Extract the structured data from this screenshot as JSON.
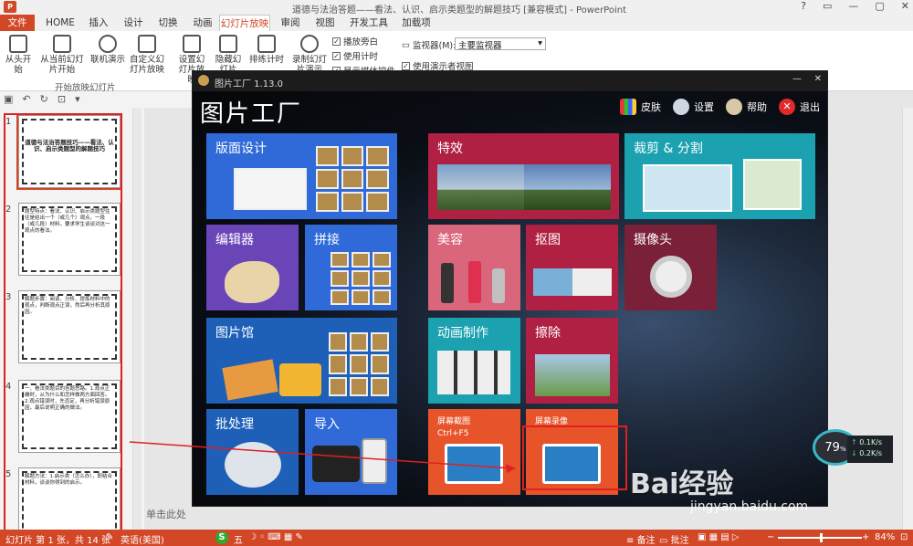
{
  "titlebar": {
    "title": "道德与法治答题——看法、认识、启示类题型的解题技巧 [兼容模式] - PowerPoint",
    "controls": [
      "?",
      "▭",
      "—",
      "▢",
      "✕"
    ]
  },
  "tabs": [
    "文件",
    "HOME",
    "插入",
    "设计",
    "切换",
    "动画",
    "幻灯片放映",
    "审阅",
    "视图",
    "开发工具",
    "加载项"
  ],
  "ribbon": {
    "from_start": "从头开始",
    "from_current": "从当前幻灯片开始",
    "online": "联机演示",
    "custom": "自定义幻灯片放映",
    "setup": "设置幻灯片放映",
    "hide": "隐藏幻灯片",
    "rehearse": "排练计时",
    "record": "录制幻灯片演示",
    "chk_play_narration": "播放旁白",
    "chk_use_timing": "使用计时",
    "chk_show_media": "显示媒体控件",
    "monitor_label": "监视器(M):",
    "monitor_value": "主要监视器",
    "presenter_view": "使用演示者视图",
    "group_label": "开始放映幻灯片"
  },
  "slides": [
    {
      "num": "1",
      "text": "道德与法治答题技巧——看法、认识、启示类题型的解题技巧"
    },
    {
      "num": "2",
      "text": "题型特点：看法、认识、启示类题型往往是给出一个（或几个）观点，一段（或几段）材料，要求学生谈谈对这一观点的看法。"
    },
    {
      "num": "3",
      "text": "解题步骤：阅读、分析、提炼材料中的观点，判断观点正误，然后再分析其原因。"
    },
    {
      "num": "4",
      "text": "一、看法类题目的答题思路。1.观点正确时，从为什么和怎样做两方面回答。2.观点错误时，先否定，再分析错误原因，最后说明正确的做法。"
    },
    {
      "num": "5",
      "text": "解题方法：1.启示类（怎么办），即结合材料，谈谈你得到的启示。"
    }
  ],
  "notes_placeholder": "单击此处",
  "statusbar": {
    "slide": "幻灯片 第 1 张，共 14 张",
    "lang": "英语(美国)",
    "notes": "备注",
    "comments": "批注",
    "zoom": "84%",
    "ime": "五"
  },
  "pf": {
    "title": "图片工厂 1.13.0",
    "name": "图片工厂",
    "skin": "皮肤",
    "settings": "设置",
    "help": "帮助",
    "exit": "退出",
    "tiles": {
      "layout": "版面设计",
      "effects": "特效",
      "crop": "裁剪 & 分割",
      "editor": "编辑器",
      "stitch": "拼接",
      "beauty": "美容",
      "cutout": "抠图",
      "camera": "摄像头",
      "gallery": "图片馆",
      "animation": "动画制作",
      "erase": "擦除",
      "batch": "批处理",
      "import": "导入",
      "screenshot": "屏幕截图",
      "screenshot_key": "Ctrl+F5",
      "record": "屏幕录像"
    }
  },
  "speed": {
    "percent": "79",
    "unit": "%",
    "up": "0.1K/s",
    "down": "0.2K/s"
  },
  "watermark": {
    "brand": "Bai经验",
    "url": "jingyan.baidu.com"
  },
  "colors": {
    "accent": "#d24726",
    "blue": "#2f6ad8",
    "crimson": "#b02042",
    "teal": "#1ba1b0",
    "orange": "#e8542a"
  }
}
